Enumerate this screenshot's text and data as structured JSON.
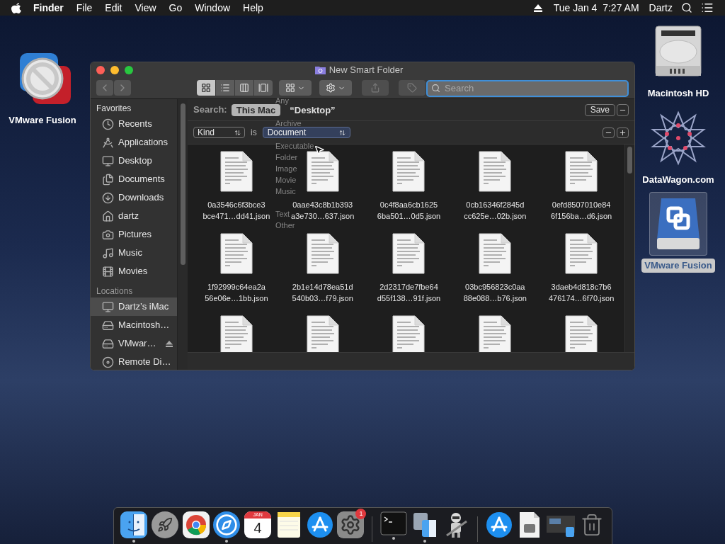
{
  "menu_bar": {
    "app": "Finder",
    "menus": [
      "File",
      "Edit",
      "View",
      "Go",
      "Window",
      "Help"
    ],
    "clock": "Tue Jan 4  7:27 AM",
    "user": "Dartz"
  },
  "desktop_left": [
    {
      "kind": "vmware-app",
      "label": "VMware Fusion",
      "selected": false
    }
  ],
  "desktop_right": [
    {
      "kind": "hard-drive",
      "label": "Macintosh HD",
      "selected": false
    },
    {
      "kind": "network-logo",
      "label": "DataWagon.com",
      "selected": false
    },
    {
      "kind": "vmware-drive",
      "label": "VMware Fusion",
      "selected": true
    }
  ],
  "window": {
    "title": "New Smart Folder",
    "navigation": [
      {
        "kind": "back",
        "disabled": true
      },
      {
        "kind": "forward",
        "disabled": true
      }
    ],
    "views": [
      {
        "kind": "icons",
        "selected": true
      },
      {
        "kind": "list",
        "selected": false
      },
      {
        "kind": "columns",
        "selected": false
      },
      {
        "kind": "gallery",
        "selected": false
      }
    ],
    "actions": [
      {
        "kind": "group",
        "disabled": false
      },
      {
        "kind": "action",
        "disabled": false
      },
      {
        "kind": "share",
        "disabled": true
      },
      {
        "kind": "tag",
        "disabled": true
      }
    ],
    "search_placeholder": "Search",
    "sidebar": [
      {
        "title": "Favorites",
        "items": [
          {
            "kind": "recents",
            "label": "Recents",
            "selected": false
          },
          {
            "kind": "applications",
            "label": "Applications",
            "selected": false
          },
          {
            "kind": "desktop",
            "label": "Desktop",
            "selected": false
          },
          {
            "kind": "documents",
            "label": "Documents",
            "selected": false
          },
          {
            "kind": "downloads",
            "label": "Downloads",
            "selected": false
          },
          {
            "kind": "home",
            "label": "dartz",
            "selected": false
          },
          {
            "kind": "pictures",
            "label": "Pictures",
            "selected": false
          },
          {
            "kind": "music",
            "label": "Music",
            "selected": false
          },
          {
            "kind": "movies",
            "label": "Movies",
            "selected": false
          }
        ]
      },
      {
        "title": "Locations",
        "items": [
          {
            "kind": "computer",
            "label": "Dartz’s iMac",
            "selected": true
          },
          {
            "kind": "hard-drive",
            "label": "Macintosh…",
            "selected": false
          },
          {
            "kind": "drive",
            "label": "VMwar…",
            "selected": false,
            "ejectable": true
          },
          {
            "kind": "disc",
            "label": "Remote Di…",
            "selected": false
          }
        ]
      }
    ],
    "search_bar": {
      "label": "Search:",
      "scopes": [
        {
          "label": "This Mac",
          "selected": true
        },
        {
          "label": "“Desktop”",
          "selected": false
        }
      ],
      "save": "Save"
    },
    "criteria": {
      "attribute": "Kind",
      "operator": "is",
      "value": "Document"
    },
    "kind_menu": [
      [
        "Any"
      ],
      [
        "Archive"
      ],
      [
        "Executable",
        "Folder",
        "Image",
        "Movie",
        "Music"
      ],
      [
        "Text",
        "Other"
      ]
    ],
    "files": [
      {
        "kind": "document",
        "name_lines": [
          "0a3546c6f3bce3",
          "bce471…dd41.json"
        ]
      },
      {
        "kind": "document",
        "name_lines": [
          "0aae43c8b1b393",
          "a3e730…637.json"
        ]
      },
      {
        "kind": "document",
        "name_lines": [
          "0c4f8aa6cb1625",
          "6ba501…0d5.json"
        ]
      },
      {
        "kind": "document",
        "name_lines": [
          "0cb16346f2845d",
          "cc625e…02b.json"
        ]
      },
      {
        "kind": "document",
        "name_lines": [
          "0efd8507010e84",
          "6f156ba…d6.json"
        ]
      },
      {
        "kind": "document",
        "name_lines": [
          "1f92999c64ea2a",
          "56e06e…1bb.json"
        ]
      },
      {
        "kind": "document",
        "name_lines": [
          "2b1e14d78ea51d",
          "540b03…f79.json"
        ]
      },
      {
        "kind": "document",
        "name_lines": [
          "2d2317de7fbe64",
          "d55f138…91f.json"
        ]
      },
      {
        "kind": "document",
        "name_lines": [
          "03bc956823c0aa",
          "88e088…b76.json"
        ]
      },
      {
        "kind": "document",
        "name_lines": [
          "3daeb4d818c7b6",
          "476174…6f70.json"
        ]
      },
      {
        "kind": "document"
      },
      {
        "kind": "document"
      },
      {
        "kind": "document"
      },
      {
        "kind": "document"
      },
      {
        "kind": "document"
      }
    ]
  },
  "dock": [
    {
      "kind": "finder",
      "running": true
    },
    {
      "kind": "launchpad",
      "running": false
    },
    {
      "kind": "chrome",
      "running": false
    },
    {
      "kind": "safari",
      "running": true
    },
    {
      "kind": "calendar",
      "month": "JAN",
      "day": "4",
      "running": false
    },
    {
      "kind": "notes",
      "running": false
    },
    {
      "kind": "app-store",
      "running": false
    },
    {
      "kind": "settings",
      "badge": "1",
      "running": false
    },
    {
      "kind": "separator"
    },
    {
      "kind": "terminal",
      "running": true
    },
    {
      "kind": "migration",
      "running": true
    },
    {
      "kind": "automator",
      "running": false
    },
    {
      "kind": "separator"
    },
    {
      "kind": "app-store",
      "running": false
    },
    {
      "kind": "document",
      "running": false
    },
    {
      "kind": "screenshot",
      "running": false
    },
    {
      "kind": "trash",
      "running": false
    }
  ]
}
